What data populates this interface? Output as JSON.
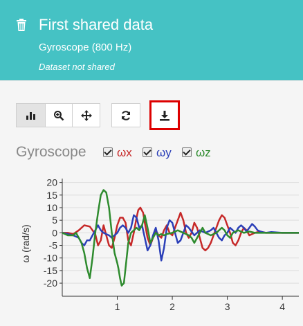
{
  "header": {
    "title": "First shared data",
    "subtitle": "Gyroscope (800 Hz)",
    "status": "Dataset not shared",
    "background_color": "#45c2c4",
    "icon": "trash-icon"
  },
  "toolbar": {
    "buttons": [
      {
        "name": "bar-chart-icon",
        "active": true
      },
      {
        "name": "zoom-icon",
        "active": false
      },
      {
        "name": "pan-icon",
        "active": false
      },
      {
        "name": "refresh-icon",
        "active": false
      },
      {
        "name": "download-icon",
        "active": false,
        "highlighted": true,
        "highlight_color": "#dd0000"
      }
    ]
  },
  "legend": {
    "chart_title": "Gyroscope",
    "items": [
      {
        "label": "ωx",
        "color": "#c62828",
        "checked": true
      },
      {
        "label": "ωy",
        "color": "#2b3fb8",
        "checked": true
      },
      {
        "label": "ωz",
        "color": "#2e8b2e",
        "checked": true
      }
    ]
  },
  "chart_data": {
    "type": "line",
    "ylabel": "ω (rad/s)",
    "xlabel": "",
    "xlim": [
      0,
      4.3
    ],
    "ylim": [
      -23,
      21
    ],
    "yticks": [
      20,
      15,
      10,
      5,
      0,
      -5,
      -10,
      -15,
      -20
    ],
    "xticks": [
      1,
      2,
      3,
      4
    ],
    "grid": true,
    "series": [
      {
        "name": "ωx",
        "color": "#c62828",
        "points": [
          [
            0,
            0
          ],
          [
            0.1,
            0
          ],
          [
            0.2,
            -0.5
          ],
          [
            0.3,
            1
          ],
          [
            0.4,
            3
          ],
          [
            0.5,
            2.5
          ],
          [
            0.6,
            -0.5
          ],
          [
            0.65,
            -5
          ],
          [
            0.7,
            -3
          ],
          [
            0.75,
            3
          ],
          [
            0.8,
            -1
          ],
          [
            0.85,
            -5
          ],
          [
            0.9,
            -6
          ],
          [
            0.95,
            -2
          ],
          [
            1.0,
            3
          ],
          [
            1.05,
            6
          ],
          [
            1.1,
            6
          ],
          [
            1.15,
            4
          ],
          [
            1.2,
            -3
          ],
          [
            1.25,
            -5
          ],
          [
            1.3,
            0
          ],
          [
            1.35,
            6
          ],
          [
            1.38,
            9
          ],
          [
            1.42,
            10
          ],
          [
            1.47,
            8
          ],
          [
            1.5,
            4
          ],
          [
            1.55,
            -2
          ],
          [
            1.6,
            -5
          ],
          [
            1.65,
            -2
          ],
          [
            1.7,
            1
          ],
          [
            1.75,
            -1
          ],
          [
            1.8,
            -2
          ],
          [
            1.85,
            1
          ],
          [
            1.9,
            3
          ],
          [
            1.95,
            0
          ],
          [
            2.0,
            -1
          ],
          [
            2.05,
            2
          ],
          [
            2.1,
            5
          ],
          [
            2.15,
            8
          ],
          [
            2.2,
            5
          ],
          [
            2.25,
            0
          ],
          [
            2.3,
            -2
          ],
          [
            2.35,
            0
          ],
          [
            2.4,
            4
          ],
          [
            2.45,
            2
          ],
          [
            2.5,
            -2
          ],
          [
            2.55,
            -6
          ],
          [
            2.6,
            -7
          ],
          [
            2.65,
            -6
          ],
          [
            2.7,
            -4
          ],
          [
            2.75,
            -1
          ],
          [
            2.8,
            2
          ],
          [
            2.85,
            5
          ],
          [
            2.9,
            7
          ],
          [
            2.95,
            6
          ],
          [
            3.0,
            3
          ],
          [
            3.05,
            0
          ],
          [
            3.1,
            -4
          ],
          [
            3.15,
            -5
          ],
          [
            3.2,
            -3
          ],
          [
            3.25,
            0
          ],
          [
            3.3,
            2
          ],
          [
            3.35,
            1
          ],
          [
            3.4,
            -1
          ],
          [
            3.5,
            0
          ],
          [
            3.6,
            0.5
          ],
          [
            3.7,
            0
          ],
          [
            3.8,
            0
          ],
          [
            4.0,
            0
          ],
          [
            4.3,
            0
          ]
        ]
      },
      {
        "name": "ωy",
        "color": "#2b3fb8",
        "points": [
          [
            0,
            0
          ],
          [
            0.1,
            -0.5
          ],
          [
            0.2,
            -1
          ],
          [
            0.3,
            -2
          ],
          [
            0.35,
            -4
          ],
          [
            0.4,
            -5
          ],
          [
            0.45,
            -3
          ],
          [
            0.5,
            -3
          ],
          [
            0.55,
            -1
          ],
          [
            0.6,
            1
          ],
          [
            0.65,
            3
          ],
          [
            0.7,
            1
          ],
          [
            0.75,
            0
          ],
          [
            0.8,
            -0.5
          ],
          [
            0.85,
            -1
          ],
          [
            0.9,
            -2
          ],
          [
            0.95,
            -1
          ],
          [
            1.0,
            0
          ],
          [
            1.05,
            2
          ],
          [
            1.1,
            3
          ],
          [
            1.15,
            2
          ],
          [
            1.2,
            0
          ],
          [
            1.25,
            2
          ],
          [
            1.3,
            7
          ],
          [
            1.35,
            6
          ],
          [
            1.4,
            2
          ],
          [
            1.45,
            3
          ],
          [
            1.5,
            -2
          ],
          [
            1.55,
            -7
          ],
          [
            1.6,
            -5
          ],
          [
            1.65,
            -1
          ],
          [
            1.7,
            2
          ],
          [
            1.75,
            -3
          ],
          [
            1.8,
            -11
          ],
          [
            1.85,
            -6
          ],
          [
            1.9,
            2
          ],
          [
            1.95,
            5
          ],
          [
            2.0,
            4
          ],
          [
            2.05,
            0
          ],
          [
            2.1,
            -4
          ],
          [
            2.15,
            -3
          ],
          [
            2.2,
            0
          ],
          [
            2.25,
            3
          ],
          [
            2.3,
            2
          ],
          [
            2.4,
            -1
          ],
          [
            2.5,
            1
          ],
          [
            2.6,
            0
          ],
          [
            2.7,
            1
          ],
          [
            2.75,
            2
          ],
          [
            2.8,
            0
          ],
          [
            2.85,
            -2
          ],
          [
            2.9,
            -3
          ],
          [
            2.95,
            -1
          ],
          [
            3.0,
            0
          ],
          [
            3.05,
            2
          ],
          [
            3.1,
            1
          ],
          [
            3.15,
            0
          ],
          [
            3.2,
            2
          ],
          [
            3.25,
            3
          ],
          [
            3.3,
            2
          ],
          [
            3.35,
            0.5
          ],
          [
            3.4,
            2
          ],
          [
            3.45,
            3.5
          ],
          [
            3.5,
            2.5
          ],
          [
            3.55,
            1
          ],
          [
            3.6,
            0.5
          ],
          [
            3.7,
            0
          ],
          [
            3.8,
            0.3
          ],
          [
            4.0,
            0
          ],
          [
            4.3,
            0
          ]
        ]
      },
      {
        "name": "ωz",
        "color": "#2e8b2e",
        "points": [
          [
            0,
            0
          ],
          [
            0.1,
            -1
          ],
          [
            0.2,
            -1
          ],
          [
            0.25,
            0
          ],
          [
            0.3,
            -2
          ],
          [
            0.35,
            -4
          ],
          [
            0.4,
            -8
          ],
          [
            0.45,
            -14
          ],
          [
            0.5,
            -18
          ],
          [
            0.55,
            -10
          ],
          [
            0.6,
            0
          ],
          [
            0.65,
            8
          ],
          [
            0.7,
            15
          ],
          [
            0.75,
            17
          ],
          [
            0.8,
            16
          ],
          [
            0.85,
            10
          ],
          [
            0.9,
            0
          ],
          [
            0.95,
            -8
          ],
          [
            1.0,
            -12
          ],
          [
            1.02,
            -14
          ],
          [
            1.05,
            -18
          ],
          [
            1.08,
            -21
          ],
          [
            1.12,
            -20
          ],
          [
            1.15,
            -14
          ],
          [
            1.2,
            -4
          ],
          [
            1.25,
            0
          ],
          [
            1.3,
            1
          ],
          [
            1.35,
            2
          ],
          [
            1.4,
            1
          ],
          [
            1.45,
            3
          ],
          [
            1.5,
            7
          ],
          [
            1.55,
            2
          ],
          [
            1.6,
            -4
          ],
          [
            1.65,
            -2
          ],
          [
            1.7,
            0
          ],
          [
            1.75,
            -1
          ],
          [
            1.8,
            -0.5
          ],
          [
            1.85,
            -1
          ],
          [
            1.9,
            -0.5
          ],
          [
            2.0,
            0
          ],
          [
            2.1,
            1
          ],
          [
            2.2,
            0
          ],
          [
            2.3,
            -1
          ],
          [
            2.35,
            -2
          ],
          [
            2.4,
            -4
          ],
          [
            2.45,
            -2
          ],
          [
            2.5,
            0
          ],
          [
            2.55,
            2
          ],
          [
            2.6,
            0
          ],
          [
            2.7,
            -1
          ],
          [
            2.8,
            0
          ],
          [
            2.85,
            1
          ],
          [
            2.9,
            2
          ],
          [
            2.95,
            1
          ],
          [
            3.0,
            -1
          ],
          [
            3.05,
            -2
          ],
          [
            3.1,
            0
          ],
          [
            3.2,
            1
          ],
          [
            3.3,
            0
          ],
          [
            3.4,
            0.5
          ],
          [
            3.5,
            0
          ],
          [
            3.7,
            0
          ],
          [
            4.0,
            0
          ],
          [
            4.3,
            0
          ]
        ]
      }
    ]
  }
}
